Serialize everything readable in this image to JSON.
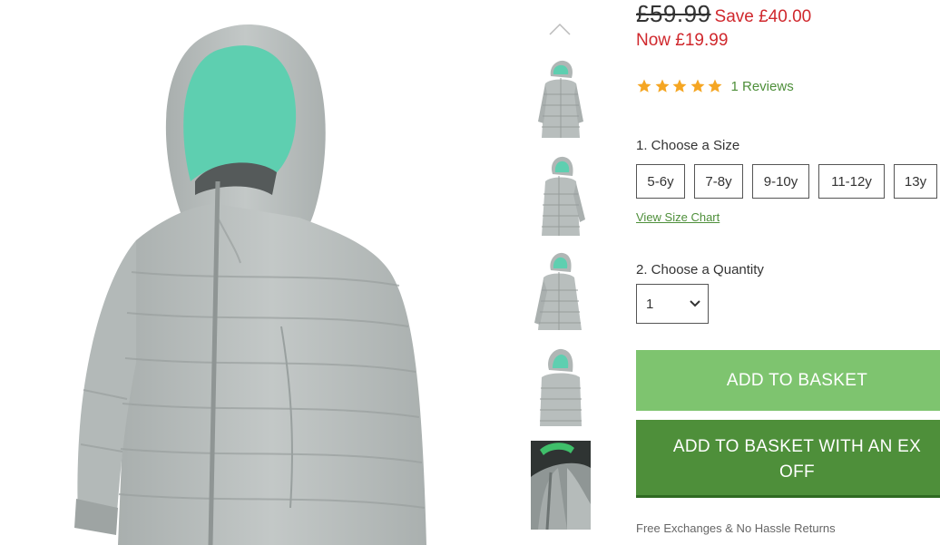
{
  "product": {
    "old_price": "£59.99",
    "save": "Save £40.00",
    "now_price": "Now £19.99",
    "rating": 5,
    "reviews": "1 Reviews"
  },
  "colors": {
    "accent_green": "#4e8f3a",
    "light_green": "#7ec46f",
    "sale_red": "#d0282d",
    "star": "#f5a623",
    "jacket_grey": "#b8bebd",
    "hood_lining": "#5ecfb0"
  },
  "icons": {
    "thumb_up": "chevron-up-icon",
    "select": "chevron-down-icon",
    "star": "star-icon"
  },
  "size": {
    "label": "1. Choose a Size",
    "options": [
      "5-6y",
      "7-8y",
      "9-10y",
      "11-12y",
      "13y"
    ],
    "chart_link": "View Size Chart"
  },
  "quantity": {
    "label": "2. Choose a Quantity",
    "value": "1"
  },
  "actions": {
    "add_to_basket": "ADD TO BASKET",
    "add_exchange_line1": "ADD TO BASKET WITH AN EX",
    "add_exchange_line2": "OFF"
  },
  "footer_note": "Free Exchanges & No Hassle Returns"
}
